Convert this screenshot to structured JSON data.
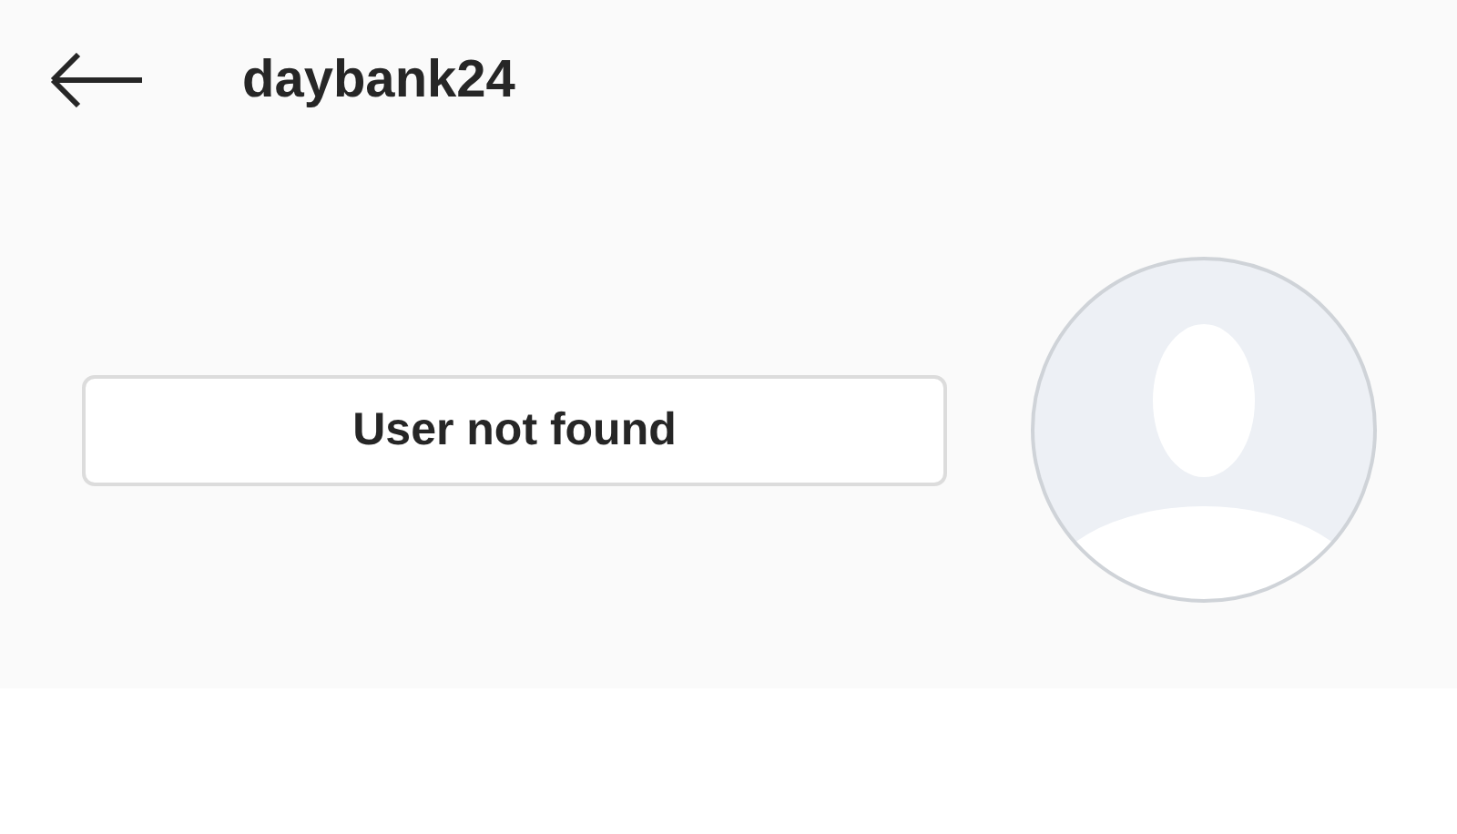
{
  "header": {
    "title": "daybank24"
  },
  "profile": {
    "status_button": "User not found"
  }
}
